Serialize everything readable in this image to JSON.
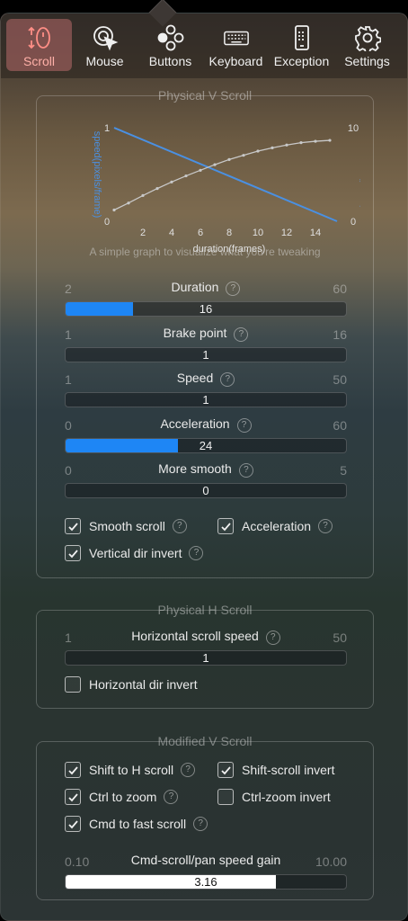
{
  "toolbar": {
    "tabs": [
      {
        "label": "Scroll",
        "icon": "scroll-wheel-icon",
        "active": true
      },
      {
        "label": "Mouse",
        "icon": "mouse-cursor-icon",
        "active": false
      },
      {
        "label": "Buttons",
        "icon": "buttons-icon",
        "active": false
      },
      {
        "label": "Keyboard",
        "icon": "keyboard-icon",
        "active": false
      },
      {
        "label": "Exception",
        "icon": "phone-icon",
        "active": false
      },
      {
        "label": "Settings",
        "icon": "gear-icon",
        "active": false
      }
    ]
  },
  "physical_v": {
    "title": "Physical V Scroll",
    "graph_caption": "A simple graph to visualize what you're tweaking",
    "sliders": [
      {
        "title": "Duration",
        "min": "2",
        "max": "60",
        "value": "16",
        "fraction": 0.24
      },
      {
        "title": "Brake point",
        "min": "1",
        "max": "16",
        "value": "1",
        "fraction": 0.0
      },
      {
        "title": "Speed",
        "min": "1",
        "max": "50",
        "value": "1",
        "fraction": 0.0
      },
      {
        "title": "Acceleration",
        "min": "0",
        "max": "60",
        "value": "24",
        "fraction": 0.4
      },
      {
        "title": "More smooth",
        "min": "0",
        "max": "5",
        "value": "0",
        "fraction": 0.0
      }
    ],
    "checks": {
      "smooth_scroll": {
        "label": "Smooth scroll",
        "checked": true
      },
      "acceleration": {
        "label": "Acceleration",
        "checked": true
      },
      "vertical_dir_invert": {
        "label": "Vertical dir invert",
        "checked": true
      }
    }
  },
  "physical_h": {
    "title": "Physical H Scroll",
    "slider": {
      "title": "Horizontal scroll speed",
      "min": "1",
      "max": "50",
      "value": "1",
      "fraction": 0.0
    },
    "checks": {
      "horizontal_dir_invert": {
        "label": "Horizontal dir invert",
        "checked": false
      }
    }
  },
  "modified_v": {
    "title": "Modified V Scroll",
    "checks": {
      "shift_to_h": {
        "label": "Shift to H scroll",
        "checked": true
      },
      "shift_invert": {
        "label": "Shift-scroll invert",
        "checked": true
      },
      "ctrl_zoom": {
        "label": "Ctrl to zoom",
        "checked": true
      },
      "ctrl_zoom_invert": {
        "label": "Ctrl-zoom invert",
        "checked": false
      },
      "cmd_fast": {
        "label": "Cmd to fast scroll",
        "checked": true
      }
    },
    "slider": {
      "title": "Cmd-scroll/pan speed gain",
      "min": "0.10",
      "max": "10.00",
      "value": "3.16",
      "fraction": 0.75
    }
  },
  "chart_data": {
    "type": "line",
    "xlabel": "duration(frames)",
    "ylabel_left": "speed(pixels/frame)",
    "ylabel_right": "distance(pixels)",
    "x_ticks": [
      "2",
      "4",
      "6",
      "8",
      "10",
      "12",
      "14"
    ],
    "left_axis": {
      "min_label": "0",
      "max_label": "1"
    },
    "right_axis": {
      "min_label": "0",
      "max_label": "10"
    },
    "xlim": [
      0,
      16
    ],
    "series": [
      {
        "name": "speed(pixels/frame)",
        "color": "#4a90e2",
        "x": [
          0,
          15.5
        ],
        "values": [
          1.0,
          0.0
        ]
      },
      {
        "name": "distance(pixels)",
        "color": "#c8c8c8",
        "x": [
          0,
          1,
          2,
          3,
          4,
          5,
          6,
          7,
          8,
          9,
          10,
          11,
          12,
          13,
          14,
          15
        ],
        "values": [
          1.2,
          1.95,
          2.75,
          3.5,
          4.2,
          4.85,
          5.45,
          6.05,
          6.6,
          7.05,
          7.5,
          7.85,
          8.15,
          8.4,
          8.55,
          8.65
        ]
      }
    ]
  },
  "colors": {
    "accent": "#1e86f5",
    "active_tab": "#ff8e86"
  }
}
